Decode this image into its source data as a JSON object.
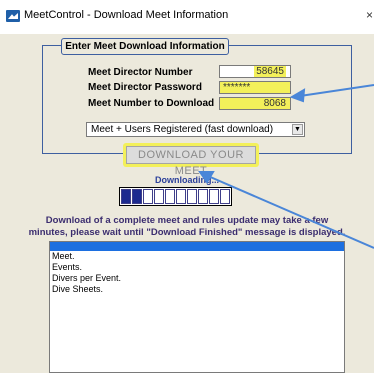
{
  "window": {
    "title": "MeetControl - Download Meet Information",
    "close_glyph": "×"
  },
  "group": {
    "legend": "Enter Meet Download Information",
    "fields": [
      {
        "label": "Meet Director Number",
        "value": "58645"
      },
      {
        "label": "Meet Director Password",
        "value": "*******"
      },
      {
        "label": "Meet Number to Download",
        "value": "8068"
      }
    ],
    "download_option": "Meet + Users Registered (fast download)"
  },
  "download_button": "DOWNLOAD YOUR MEET",
  "status": "Downloading...",
  "progress": {
    "filled": 2,
    "total": 10
  },
  "info_text": [
    "Download of a complete meet and rules update may take a few",
    "minutes, please wait until \"Download Finished\" message is displayed."
  ],
  "log_items": [
    "Meet.",
    "Events.",
    "Divers per Event.",
    "Dive Sheets."
  ],
  "colors": {
    "highlight": "#f3f05a",
    "annotation_arrow": "#4a86d8",
    "progress_fill": "#1c2a8f",
    "list_header": "#1c6fe0"
  },
  "icons": {
    "app": "meetcontrol-app-icon",
    "dropdown": "chevron-down-icon"
  }
}
